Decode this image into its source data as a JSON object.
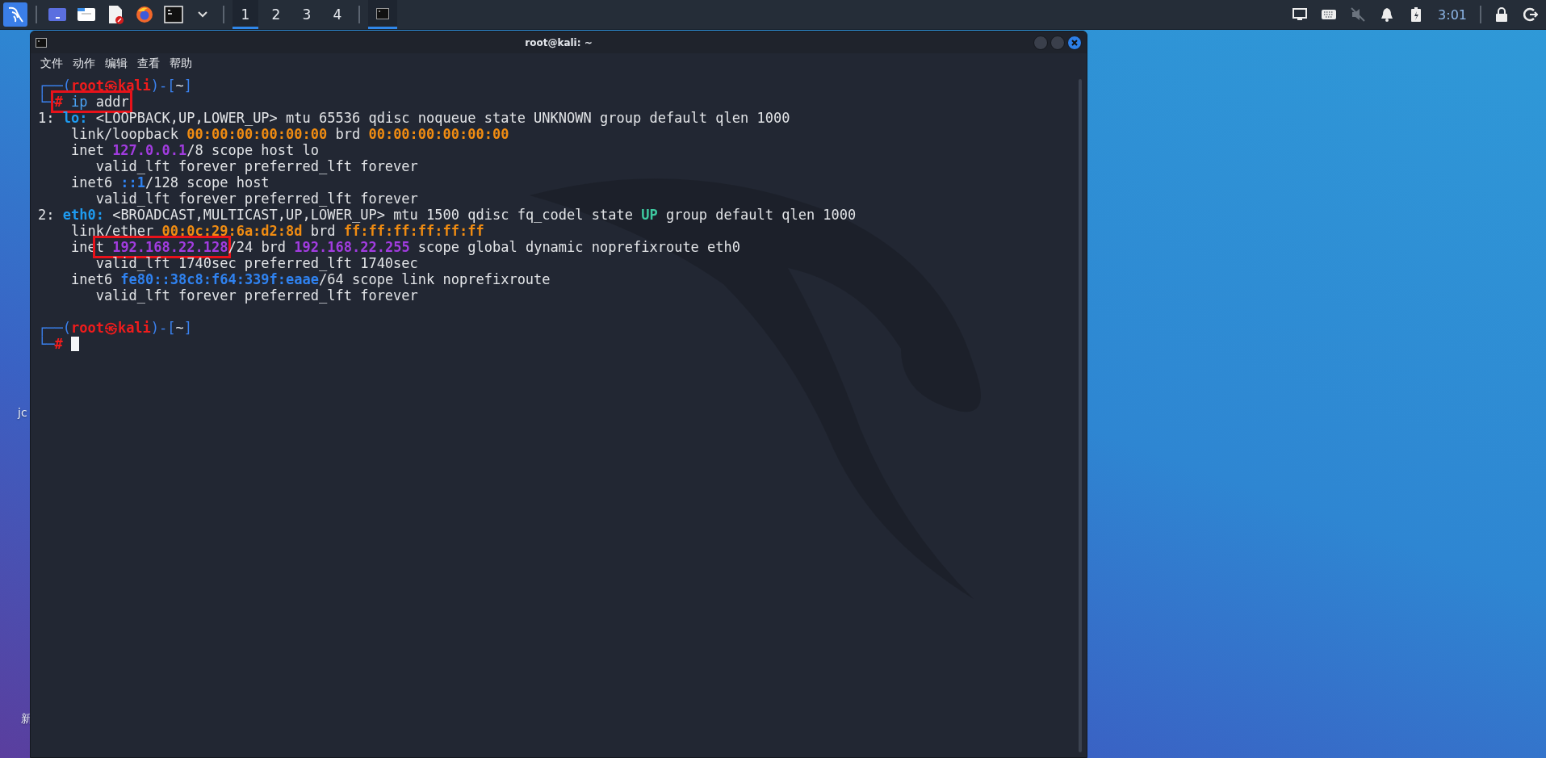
{
  "taskbar": {
    "workspaces": [
      {
        "label": "1",
        "selected": true
      },
      {
        "label": "2",
        "selected": false
      },
      {
        "label": "3",
        "selected": false
      },
      {
        "label": "4",
        "selected": false
      }
    ],
    "tasks": [
      {
        "selected": true
      }
    ],
    "clock": "3:01"
  },
  "desktop": {
    "labels": [
      "jc",
      "新"
    ]
  },
  "window": {
    "title": "root@kali: ~",
    "menu": [
      "文件",
      "动作",
      "编辑",
      "查看",
      "帮助"
    ],
    "blocks": [
      {
        "lines": [
          {
            "segments": [
              {
                "kind": "prompt",
                "text": "┌──("
              },
              {
                "kind": "user",
                "text": "root㉿kali"
              },
              {
                "kind": "prompt",
                "text": ")-["
              },
              {
                "kind": "plain",
                "text": "~"
              },
              {
                "kind": "prompt",
                "text": "]"
              }
            ]
          },
          {
            "segments": [
              {
                "kind": "prompt",
                "text": "└─"
              },
              {
                "kind": "box",
                "segments": [
                  {
                    "kind": "user",
                    "text": "# "
                  },
                  {
                    "kind": "cmd",
                    "text": "ip"
                  },
                  {
                    "kind": "plain",
                    "text": " addr"
                  }
                ]
              }
            ]
          },
          {
            "segments": [
              {
                "kind": "plain",
                "text": "1: "
              },
              {
                "kind": "dev",
                "text": "lo:"
              },
              {
                "kind": "plain",
                "text": " <LOOPBACK,UP,LOWER_UP> mtu 65536 qdisc noqueue state UNKNOWN group default qlen 1000"
              }
            ]
          },
          {
            "segments": [
              {
                "kind": "plain",
                "text": "    link/loopback "
              },
              {
                "kind": "mac",
                "text": "00:00:00:00:00:00"
              },
              {
                "kind": "plain",
                "text": " brd "
              },
              {
                "kind": "mac",
                "text": "00:00:00:00:00:00"
              }
            ]
          },
          {
            "segments": [
              {
                "kind": "plain",
                "text": "    inet "
              },
              {
                "kind": "ip4",
                "text": "127.0.0.1"
              },
              {
                "kind": "plain",
                "text": "/8 scope host lo"
              }
            ]
          },
          {
            "segments": [
              {
                "kind": "plain",
                "text": "       valid_lft forever preferred_lft forever"
              }
            ]
          },
          {
            "segments": [
              {
                "kind": "plain",
                "text": "    inet6 "
              },
              {
                "kind": "ip6",
                "text": "::1"
              },
              {
                "kind": "plain",
                "text": "/128 scope host"
              }
            ]
          },
          {
            "segments": [
              {
                "kind": "plain",
                "text": "       valid_lft forever preferred_lft forever"
              }
            ]
          },
          {
            "segments": [
              {
                "kind": "plain",
                "text": "2: "
              },
              {
                "kind": "dev",
                "text": "eth0:"
              },
              {
                "kind": "plain",
                "text": " <BROADCAST,MULTICAST,UP,LOWER_UP> mtu 1500 qdisc fq_codel state "
              },
              {
                "kind": "up",
                "text": "UP"
              },
              {
                "kind": "plain",
                "text": " group default qlen 1000"
              }
            ]
          },
          {
            "segments": [
              {
                "kind": "plain",
                "text": "    link/ether "
              },
              {
                "kind": "mac",
                "text": "00:0c:29:6a:d2:8d"
              },
              {
                "kind": "plain",
                "text": " brd "
              },
              {
                "kind": "mac",
                "text": "ff:ff:ff:ff:ff:ff"
              }
            ]
          },
          {
            "segments": [
              {
                "kind": "plain",
                "text": "    ine"
              },
              {
                "kind": "box",
                "segments": [
                  {
                    "kind": "plain",
                    "text": "t "
                  },
                  {
                    "kind": "ip4",
                    "text": "192.168.22.128"
                  }
                ]
              },
              {
                "kind": "plain",
                "text": "/24 brd "
              },
              {
                "kind": "ip4",
                "text": "192.168.22.255"
              },
              {
                "kind": "plain",
                "text": " scope global dynamic noprefixroute eth0"
              }
            ]
          },
          {
            "segments": [
              {
                "kind": "plain",
                "text": "       valid_lft 1740sec preferred_lft 1740sec"
              }
            ]
          },
          {
            "segments": [
              {
                "kind": "plain",
                "text": "    inet6 "
              },
              {
                "kind": "ip6",
                "text": "fe80::38c8:f64:339f:eaae"
              },
              {
                "kind": "plain",
                "text": "/64 scope link noprefixroute"
              }
            ]
          },
          {
            "segments": [
              {
                "kind": "plain",
                "text": "       valid_lft forever preferred_lft forever"
              }
            ]
          }
        ]
      },
      {
        "lines": [
          {
            "segments": [
              {
                "kind": "prompt",
                "text": "┌──("
              },
              {
                "kind": "user",
                "text": "root㉿kali"
              },
              {
                "kind": "prompt",
                "text": ")-["
              },
              {
                "kind": "plain",
                "text": "~"
              },
              {
                "kind": "prompt",
                "text": "]"
              }
            ]
          },
          {
            "segments": [
              {
                "kind": "prompt",
                "text": "└─"
              },
              {
                "kind": "user",
                "text": "#"
              }
            ]
          }
        ]
      }
    ]
  }
}
